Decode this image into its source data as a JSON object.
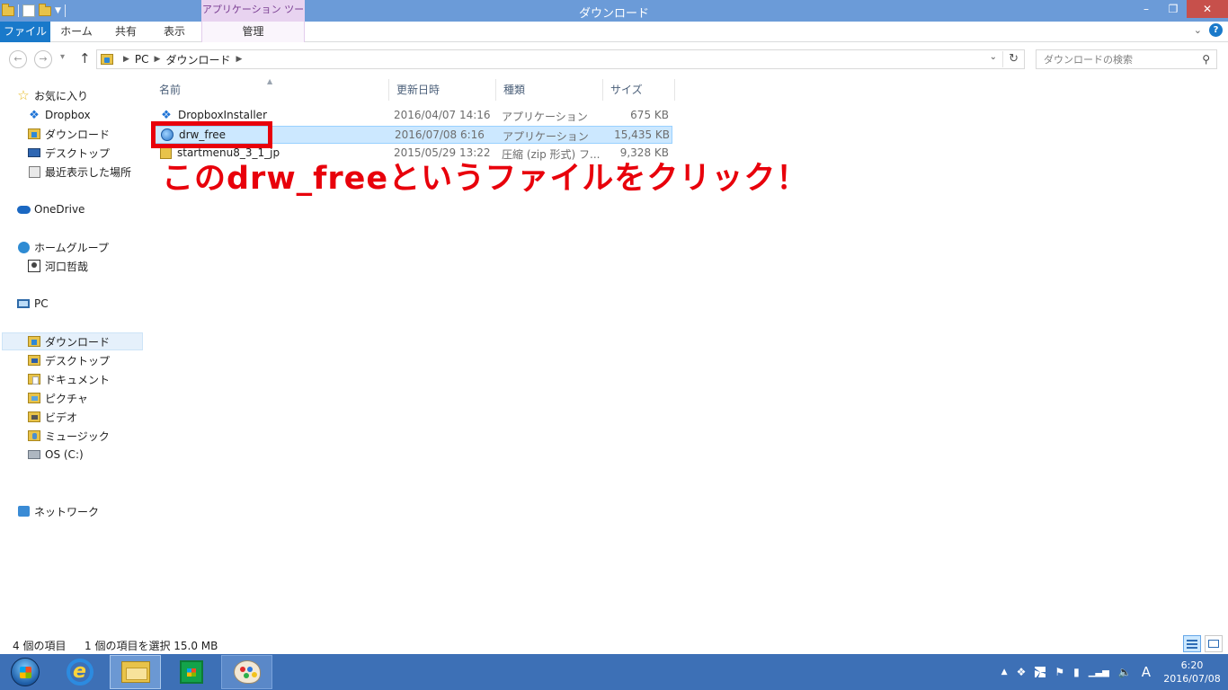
{
  "window": {
    "title": "ダウンロード",
    "context_tab": "アプリケーション ツール",
    "controls": {
      "minimize": "–",
      "maximize": "❐",
      "close": "✕"
    }
  },
  "ribbon": {
    "tabs": [
      {
        "label": "ファイル"
      },
      {
        "label": "ホーム"
      },
      {
        "label": "共有"
      },
      {
        "label": "表示"
      },
      {
        "label": "管理"
      }
    ],
    "help": "?"
  },
  "address": {
    "crumbs": [
      "PC",
      "ダウンロード"
    ],
    "search_placeholder": "ダウンロードの検索"
  },
  "nav": {
    "favorites": "お気に入り",
    "dropbox": "Dropbox",
    "downloads": "ダウンロード",
    "desktop": "デスクトップ",
    "recent": "最近表示した場所",
    "onedrive": "OneDrive",
    "homegroup": "ホームグループ",
    "user": "河口哲哉",
    "pc": "PC",
    "pc_downloads": "ダウンロード",
    "pc_desktop": "デスクトップ",
    "documents": "ドキュメント",
    "pictures": "ピクチャ",
    "videos": "ビデオ",
    "music": "ミュージック",
    "drive": "OS (C:)",
    "network": "ネットワーク"
  },
  "columns": {
    "name": "名前",
    "modified": "更新日時",
    "type": "種類",
    "size": "サイズ"
  },
  "files": [
    {
      "name": "DropboxInstaller",
      "modified": "2016/04/07 14:16",
      "type": "アプリケーション",
      "size": "675 KB",
      "icon": "dropbox-icon"
    },
    {
      "name": "drw_free",
      "modified": "2016/07/08 6:16",
      "type": "アプリケーション",
      "size": "15,435 KB",
      "icon": "globe-icon"
    },
    {
      "name": "startmenu8_3_1_jp",
      "modified": "2015/05/29 13:22",
      "type": "圧縮 (zip 形式) フ...",
      "size": "9,328 KB",
      "icon": "zip-icon"
    }
  ],
  "annotation": "このdrw_freeというファイルをクリック！",
  "status": {
    "count": "4 個の項目",
    "selection": "1 個の項目を選択 15.0 MB"
  },
  "taskbar": {
    "time": "6:20",
    "date": "2016/07/08",
    "ime": "A"
  },
  "colors": {
    "accent": "#1979ca",
    "titlebar": "#6b9bd8",
    "annotation": "#e8000b",
    "taskbar": "#3d70b6"
  }
}
